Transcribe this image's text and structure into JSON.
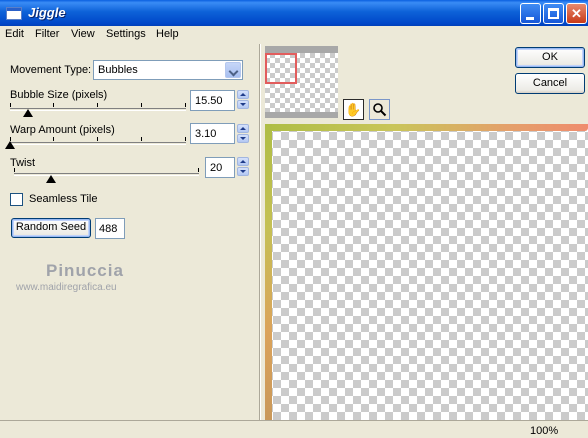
{
  "window": {
    "title": "Jiggle"
  },
  "menu": [
    "Edit",
    "Filter",
    "View",
    "Settings",
    "Help"
  ],
  "movement": {
    "label": "Movement Type:",
    "value": "Bubbles"
  },
  "bubble_size": {
    "label": "Bubble Size (pixels)",
    "value": "15.50",
    "level": 0.1
  },
  "warp_amount": {
    "label": "Warp Amount (pixels)",
    "value": "3.10",
    "level": 0.0
  },
  "twist": {
    "label": "Twist",
    "value": "20",
    "level": 0.2
  },
  "seamless": {
    "label": "Seamless Tile",
    "checked": false
  },
  "seed": {
    "button_label": "Random Seed",
    "value": "488"
  },
  "buttons": {
    "ok": "OK",
    "cancel": "Cancel"
  },
  "watermark": {
    "name": "Pinuccia",
    "url": "www.maidiregrafica.eu"
  },
  "status": {
    "zoom": "100%"
  },
  "icons": {
    "pan": "hand-icon",
    "zoom": "magnifier-icon"
  }
}
